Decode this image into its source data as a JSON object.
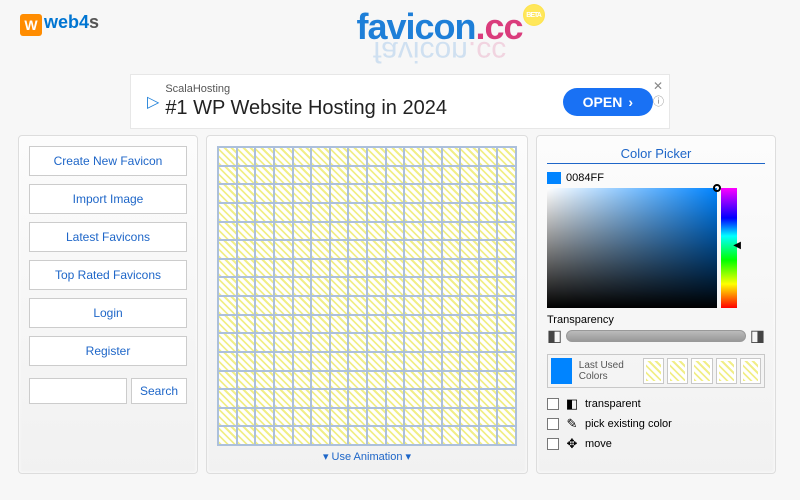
{
  "header": {
    "logo_mark": "W",
    "logo_text_a": "web4",
    "logo_text_b": "s",
    "brand_favicon": "favicon",
    "brand_dot": ".",
    "brand_cc": "cc",
    "badge": "BETA"
  },
  "ad": {
    "tag": "ScalaHosting",
    "title": "#1 WP Website Hosting in 2024",
    "cta": "OPEN"
  },
  "sidebar": {
    "items": [
      "Create New Favicon",
      "Import Image",
      "Latest Favicons",
      "Top Rated Favicons",
      "Login",
      "Register"
    ],
    "search_btn": "Search"
  },
  "canvas": {
    "use_animation_label": "Use Animation"
  },
  "picker": {
    "title": "Color Picker",
    "hex": "0084FF",
    "transparency_label": "Transparency",
    "last_used_label": "Last Used Colors",
    "tool_transparent": "transparent",
    "tool_pick": "pick existing color",
    "tool_move": "move"
  }
}
